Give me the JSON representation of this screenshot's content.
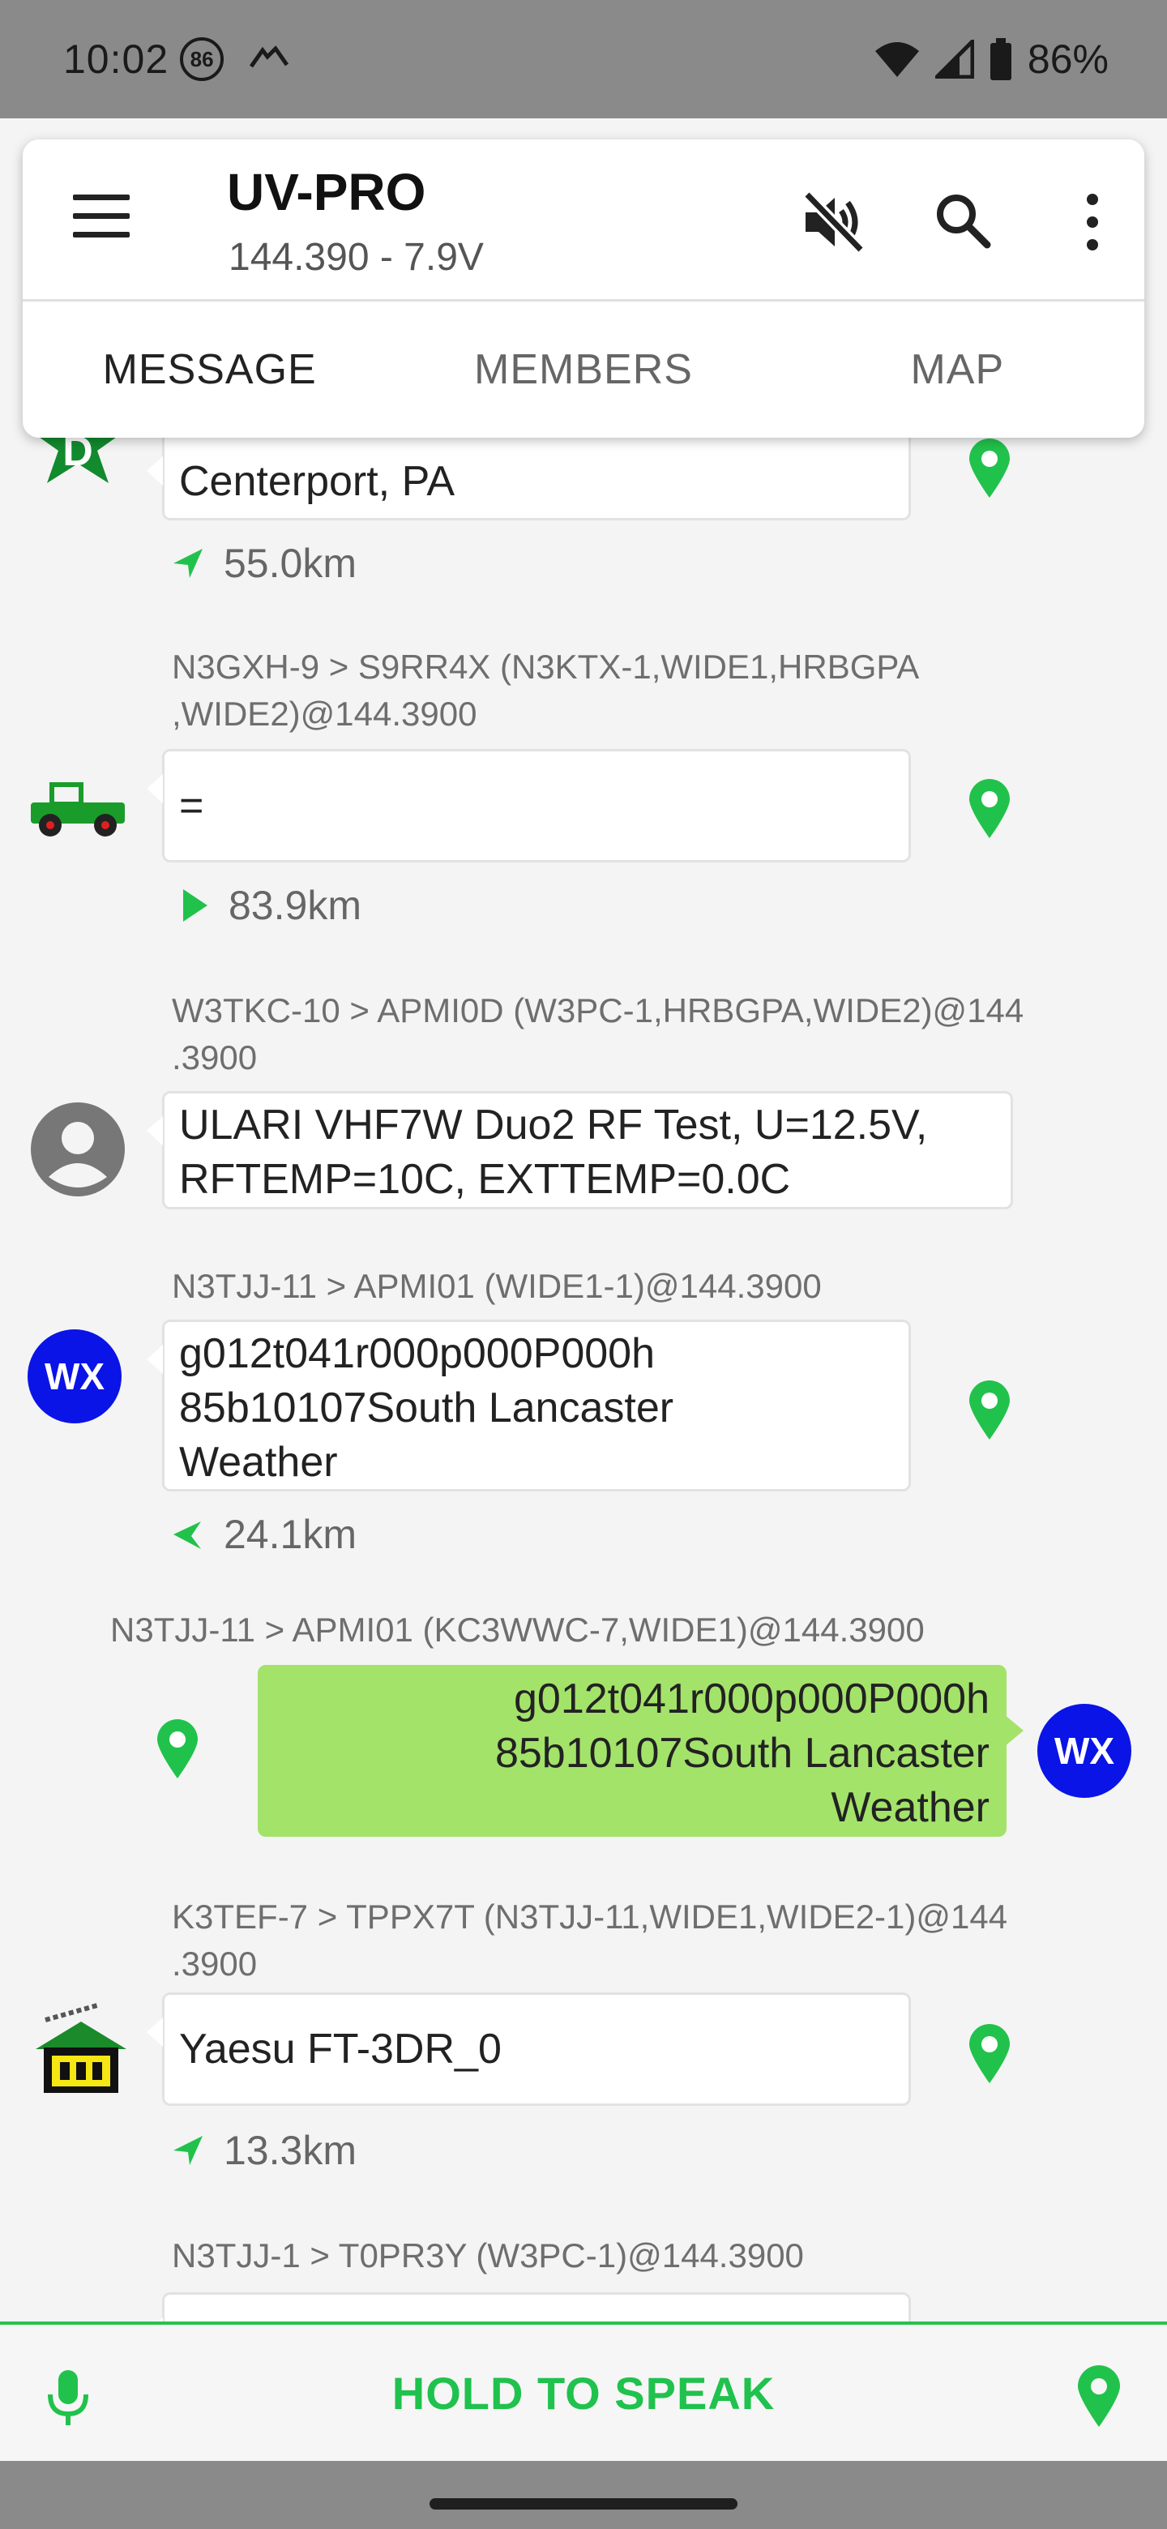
{
  "status_bar": {
    "time": "10:02",
    "badge": "86",
    "battery": "86%"
  },
  "app_bar": {
    "title": "UV-PRO",
    "subtitle": "144.390 - 7.9V"
  },
  "tabs": [
    {
      "label": "MESSAGE",
      "active": true
    },
    {
      "label": "MEMBERS",
      "active": false
    },
    {
      "label": "MAP",
      "active": false
    }
  ],
  "messages": [
    {
      "header": "",
      "avatar": "green-star-d-icon",
      "avatar_letter": "D",
      "text_lines": [
        "Centerport, PA"
      ],
      "distance": "55.0km"
    },
    {
      "header_lines": [
        "N3GXH-9 > S9RR4X (N3KTX-1,WIDE1,HRBGPA",
        ",WIDE2)@144.3900"
      ],
      "avatar": "jeep-icon",
      "text_lines": [
        "="
      ],
      "distance": "83.9km"
    },
    {
      "header_lines": [
        "W3TKC-10 > APMI0D (W3PC-1,HRBGPA,WIDE2)@144",
        ".3900"
      ],
      "avatar": "person-icon",
      "text_lines": [
        "ULARI VHF7W Duo2 RF Test, U=12.5V,",
        "RFTEMP=10C, EXTTEMP=0.0C"
      ]
    },
    {
      "header_lines": [
        "N3TJJ-11 > APMI01 (WIDE1-1)@144.3900"
      ],
      "avatar": "wx-icon",
      "avatar_letter": "WX",
      "text_lines": [
        "g012t041r000p000P000h",
        "85b10107South Lancaster",
        "Weather"
      ],
      "distance": "24.1km"
    },
    {
      "header_lines": [
        "N3TJJ-11 > APMI01 (KC3WWC-7,WIDE1)@144.3900"
      ],
      "avatar": "wx-icon",
      "avatar_letter": "WX",
      "text_lines": [
        "g012t041r000p000P000h",
        "85b10107South Lancaster",
        "Weather"
      ],
      "sent": true
    },
    {
      "header_lines": [
        "K3TEF-7 > TPPX7T (N3TJJ-11,WIDE1,WIDE2-1)@144",
        ".3900"
      ],
      "avatar": "house-antenna-icon",
      "text_lines": [
        "Yaesu FT-3DR_0"
      ],
      "distance": "13.3km"
    },
    {
      "header_lines": [
        "N3TJJ-1 > T0PR3Y (W3PC-1)@144.3900"
      ]
    }
  ],
  "bottom_bar": {
    "speak_label": "HOLD TO SPEAK"
  },
  "colors": {
    "accent": "#1fc24d",
    "sent_bubble": "#a3e36a",
    "wx_avatar": "#0a14e6"
  }
}
